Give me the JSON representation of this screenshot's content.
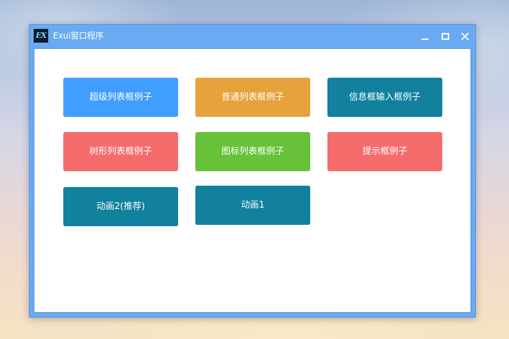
{
  "window": {
    "title": "Exui窗口程序",
    "logo_text": "EX",
    "logo_icon": "app-logo-icon"
  },
  "controls": {
    "minimize_icon": "minimize-icon",
    "maximize_icon": "maximize-icon",
    "close_icon": "close-icon"
  },
  "buttons": [
    {
      "label": "超级列表框例子",
      "color": "#409eff"
    },
    {
      "label": "普通列表框例子",
      "color": "#e6a23c"
    },
    {
      "label": "信息框输入框例子",
      "color": "#11819e"
    },
    {
      "label": "树形列表框例子",
      "color": "#f56c6c"
    },
    {
      "label": "图标列表框例子",
      "color": "#67c23a"
    },
    {
      "label": "提示框例子",
      "color": "#f56c6c"
    },
    {
      "label": "动画2(推荐)",
      "color": "#11819e"
    },
    {
      "label": "动画1",
      "color": "#11819e"
    }
  ],
  "colors": {
    "titlebar": "#6aaaf3",
    "client_bg": "#ffffff"
  }
}
